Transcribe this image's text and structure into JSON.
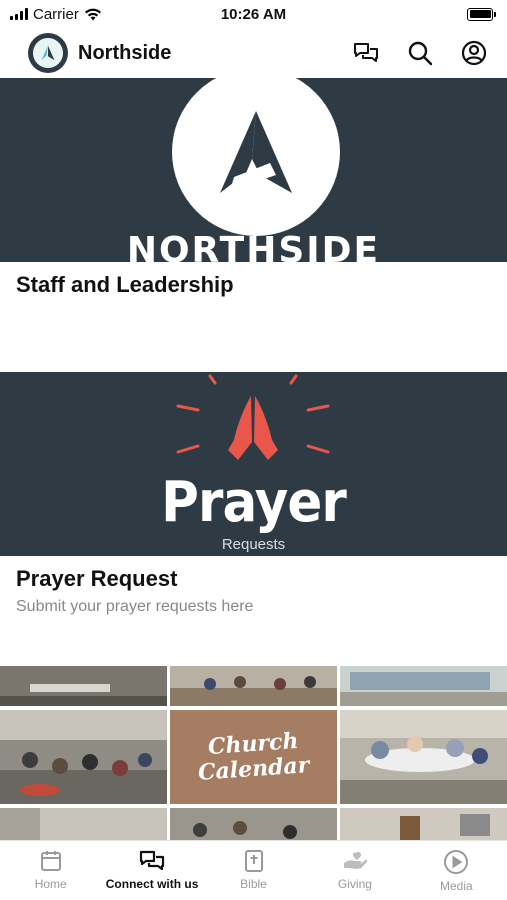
{
  "status_bar": {
    "carrier": "Carrier",
    "time": "10:26 AM"
  },
  "header": {
    "title": "Northside",
    "icons": [
      "chat-icon",
      "search-icon",
      "account-icon"
    ]
  },
  "cards": [
    {
      "banner_text": "NORTHSIDE",
      "title": "Staff and Leadership",
      "subtitle": ""
    },
    {
      "banner_text": "Prayer",
      "banner_subtext": "Requests",
      "title": "Prayer Request",
      "subtitle": "Submit your prayer requests here"
    }
  ],
  "photo_grid": {
    "calendar_line1": "Church",
    "calendar_line2": "Calendar"
  },
  "tabs": [
    {
      "label": "Home",
      "icon": "calendar-icon",
      "active": false
    },
    {
      "label": "Connect with us",
      "icon": "chat-icon",
      "active": true
    },
    {
      "label": "Bible",
      "icon": "bible-icon",
      "active": false
    },
    {
      "label": "Giving",
      "icon": "giving-hand-icon",
      "active": false
    },
    {
      "label": "Media",
      "icon": "play-icon",
      "active": false
    }
  ],
  "colors": {
    "banner": "#2f3b44",
    "prayer_accent": "#e8574a",
    "calendar_tile": "#a57d62",
    "tab_active": "#111111",
    "tab_inactive": "#9a9a9a"
  }
}
